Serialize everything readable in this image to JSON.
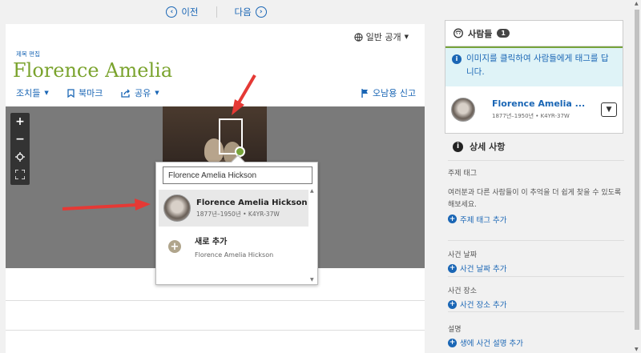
{
  "nav": {
    "prev_label": "이전",
    "next_label": "다음"
  },
  "header": {
    "privacy_label": "일반 공개",
    "edit_title_label": "제목 편집",
    "title": "Florence Amelia"
  },
  "toolbar": {
    "actions_label": "조치들",
    "bookmark_label": "북마크",
    "share_label": "공유",
    "report_label": "오남용 신고"
  },
  "tag_popup": {
    "search_value": "Florence Amelia Hickson",
    "result": {
      "name": "Florence Amelia Hickson",
      "meta": "1877년–1950년 • K4YR-37W"
    },
    "add_new": {
      "label": "새로 추가",
      "sub": "Florence Amelia Hickson"
    }
  },
  "sidebar": {
    "people": {
      "title": "사람들",
      "count": "1",
      "info_text": "이미지를 클릭하여 사람들에게 태그를 답니다.",
      "person": {
        "name": "Florence Amelia ...",
        "meta": "1877년–1950년 • K4YR-37W"
      }
    },
    "details": {
      "title": "상세 사항",
      "topic_tags": {
        "label": "주제 태그",
        "desc": "여러분과 다른 사람들이 이 추억을 더 쉽게 찾을 수 있도록 해보세요.",
        "add": "주제 태그 추가"
      },
      "event_date": {
        "label": "사건 날짜",
        "add": "사건 날짜 추가"
      },
      "event_place": {
        "label": "사건 장소",
        "add": "사건 장소 추가"
      },
      "description": {
        "label": "설명",
        "add": "생에 사건 설명 추가"
      }
    }
  },
  "colors": {
    "accent_blue": "#1a66b5",
    "title_green": "#7aa32d",
    "arrow_red": "#e53935"
  },
  "icons": [
    "chevron-left-icon",
    "chevron-right-icon",
    "globe-icon",
    "bookmark-icon",
    "share-icon",
    "flag-icon",
    "zoom-in-icon",
    "zoom-out-icon",
    "locate-icon",
    "fullscreen-icon",
    "plus-icon",
    "info-icon",
    "person-icon",
    "chevron-down-icon"
  ]
}
